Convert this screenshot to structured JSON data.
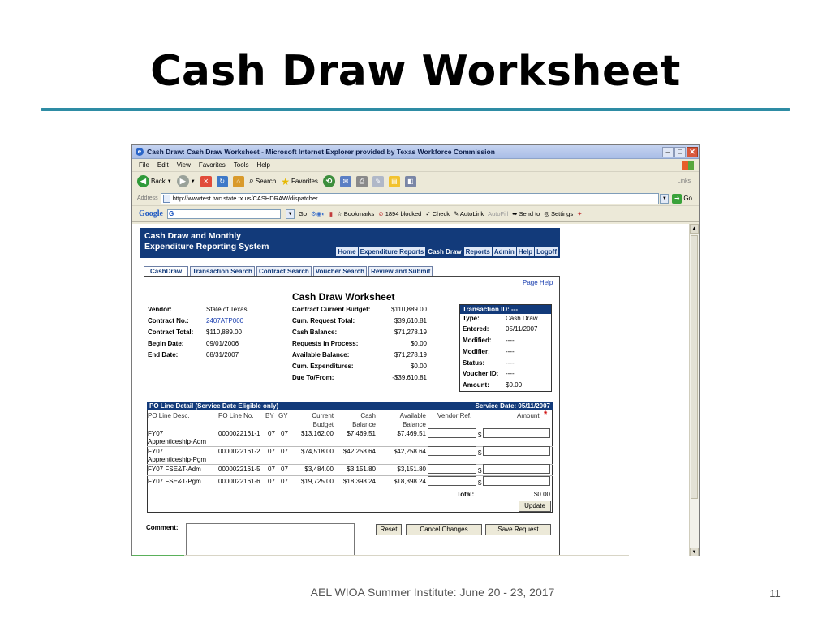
{
  "slide": {
    "title": "Cash Draw Worksheet",
    "footer": "AEL WIOA Summer Institute: June 20 - 23, 2017",
    "page_number": "11"
  },
  "browser": {
    "window_title": "Cash Draw: Cash Draw Worksheet - Microsoft Internet Explorer provided by Texas Workforce Commission",
    "menu": [
      "File",
      "Edit",
      "View",
      "Favorites",
      "Tools",
      "Help"
    ],
    "toolbar": {
      "back": "Back",
      "search": "Search",
      "favorites": "Favorites",
      "links": "Links"
    },
    "address_label": "Address",
    "address_url": "http://wwwtest.twc.state.tx.us/CASHDRAW/dispatcher",
    "go_label": "Go",
    "google": {
      "logo": "Google",
      "go": "Go",
      "bookmarks": "Bookmarks",
      "blocked": "1894 blocked",
      "check": "Check",
      "autolink": "AutoLink",
      "autofill": "AutoFill",
      "sendto": "Send to",
      "settings": "Settings"
    }
  },
  "app": {
    "header_line1": "Cash Draw and Monthly",
    "header_line2": "Expenditure Reporting System",
    "nav": [
      "Home",
      "Expenditure Reports",
      "Cash Draw",
      "Reports",
      "Admin",
      "Help",
      "Logoff"
    ],
    "active_nav": "Cash Draw",
    "tabs": [
      "CashDraw",
      "Transaction Search",
      "Contract Search",
      "Voucher Search",
      "Review and Submit"
    ],
    "page_help": "Page Help",
    "worksheet_title": "Cash Draw Worksheet",
    "vendor_info": {
      "vendor_label": "Vendor:",
      "vendor": "State of Texas",
      "contract_no_label": "Contract No.:",
      "contract_no": "2407ATP000",
      "contract_total_label": "Contract Total:",
      "contract_total": "$110,889.00",
      "begin_date_label": "Begin Date:",
      "begin_date": "09/01/2006",
      "end_date_label": "End Date:",
      "end_date": "08/31/2007"
    },
    "budget_info": {
      "ccb_label": "Contract Current Budget:",
      "ccb": "$110,889.00",
      "crt_label": "Cum. Request Total:",
      "crt": "$39,610.81",
      "cb_label": "Cash Balance:",
      "cb": "$71,278.19",
      "rip_label": "Requests in Process:",
      "rip": "$0.00",
      "ab_label": "Available Balance:",
      "ab": "$71,278.19",
      "ce_label": "Cum. Expenditures:",
      "ce": "$0.00",
      "dtf_label": "Due To/From:",
      "dtf": "-$39,610.81"
    },
    "transaction": {
      "header": "Transaction ID: ---",
      "type_label": "Type:",
      "type": "Cash Draw",
      "entered_label": "Entered:",
      "entered": "05/11/2007",
      "modified_label": "Modified:",
      "modified": "----",
      "modifier_label": "Modifier:",
      "modifier": "----",
      "status_label": "Status:",
      "status": "----",
      "voucher_label": "Voucher ID:",
      "voucher": "----",
      "amount_label": "Amount:",
      "amount": "$0.00"
    },
    "po": {
      "header_left": "PO Line Detail (Service Date Eligible only)",
      "header_right": "Service Date: 05/11/2007",
      "columns": {
        "desc": "PO Line Desc.",
        "no": "PO Line No.",
        "by": "BY",
        "gy": "GY",
        "cur1": "Current",
        "cur2": "Budget",
        "cash1": "Cash",
        "cash2": "Balance",
        "avail1": "Available",
        "avail2": "Balance",
        "vendor_ref": "Vendor Ref.",
        "amount": "Amount",
        "required": "*"
      },
      "rows": [
        {
          "desc1": "FY07",
          "desc2": "Apprenticeship-Adm",
          "no": "0000022161-1",
          "by": "07",
          "gy": "07",
          "budget": "$13,162.00",
          "cash": "$7,469.51",
          "avail": "$7,469.51"
        },
        {
          "desc1": "FY07",
          "desc2": "Apprenticeship-Pgm",
          "no": "0000022161-2",
          "by": "07",
          "gy": "07",
          "budget": "$74,518.00",
          "cash": "$42,258.64",
          "avail": "$42,258.64"
        },
        {
          "desc1": "FY07 FSE&T-Adm",
          "desc2": "",
          "no": "0000022161-5",
          "by": "07",
          "gy": "07",
          "budget": "$3,484.00",
          "cash": "$3,151.80",
          "avail": "$3,151.80"
        },
        {
          "desc1": "FY07 FSE&T-Pgm",
          "desc2": "",
          "no": "0000022161-6",
          "by": "07",
          "gy": "07",
          "budget": "$19,725.00",
          "cash": "$18,398.24",
          "avail": "$18,398.24"
        }
      ],
      "dollar": "$",
      "total_label": "Total:",
      "total_value": "$0.00",
      "update": "Update"
    },
    "comment_label": "Comment:",
    "buttons": {
      "reset": "Reset",
      "cancel": "Cancel Changes",
      "save": "Save Request"
    }
  }
}
